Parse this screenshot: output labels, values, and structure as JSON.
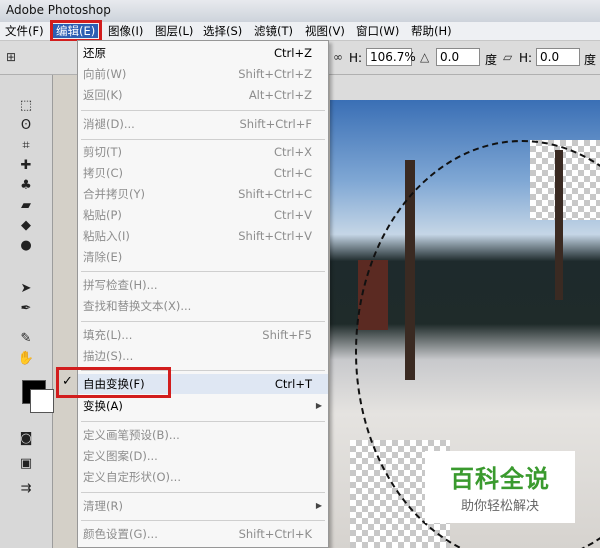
{
  "window": {
    "title": "Adobe Photoshop"
  },
  "menubar": {
    "items": [
      "文件(F)",
      "编辑(E)",
      "图像(I)",
      "图层(L)",
      "选择(S)",
      "滤镜(T)",
      "视图(V)",
      "窗口(W)",
      "帮助(H)"
    ],
    "active": "编辑(E)"
  },
  "options": {
    "h_label": "H:",
    "h_value": "106.7%",
    "angle_value": "0.0",
    "angle_unit": "度",
    "skew_h_label": "H:",
    "skew_h_value": "0.0",
    "skew_unit": "度"
  },
  "edit_menu": {
    "items": [
      {
        "label": "还原",
        "shortcut": "Ctrl+Z",
        "enabled": true
      },
      {
        "label": "向前(W)",
        "shortcut": "Shift+Ctrl+Z",
        "enabled": false
      },
      {
        "label": "返回(K)",
        "shortcut": "Alt+Ctrl+Z",
        "enabled": false
      },
      {
        "label": "消褪(D)...",
        "shortcut": "Shift+Ctrl+F",
        "enabled": false
      },
      {
        "label": "剪切(T)",
        "shortcut": "Ctrl+X",
        "enabled": false
      },
      {
        "label": "拷贝(C)",
        "shortcut": "Ctrl+C",
        "enabled": false
      },
      {
        "label": "合并拷贝(Y)",
        "shortcut": "Shift+Ctrl+C",
        "enabled": false
      },
      {
        "label": "粘贴(P)",
        "shortcut": "Ctrl+V",
        "enabled": false
      },
      {
        "label": "粘贴入(I)",
        "shortcut": "Shift+Ctrl+V",
        "enabled": false
      },
      {
        "label": "清除(E)",
        "shortcut": "",
        "enabled": false
      },
      {
        "label": "拼写检查(H)...",
        "shortcut": "",
        "enabled": false
      },
      {
        "label": "查找和替换文本(X)...",
        "shortcut": "",
        "enabled": false
      },
      {
        "label": "填充(L)...",
        "shortcut": "Shift+F5",
        "enabled": false
      },
      {
        "label": "描边(S)...",
        "shortcut": "",
        "enabled": false
      },
      {
        "label": "自由变换(F)",
        "shortcut": "Ctrl+T",
        "enabled": true,
        "checked": true
      },
      {
        "label": "变换(A)",
        "shortcut": "",
        "enabled": true,
        "submenu": true
      },
      {
        "label": "定义画笔预设(B)...",
        "shortcut": "",
        "enabled": false
      },
      {
        "label": "定义图案(D)...",
        "shortcut": "",
        "enabled": false
      },
      {
        "label": "定义自定形状(O)...",
        "shortcut": "",
        "enabled": false
      },
      {
        "label": "清理(R)",
        "shortcut": "",
        "enabled": false,
        "submenu": true
      },
      {
        "label": "颜色设置(G)...",
        "shortcut": "Shift+Ctrl+K",
        "enabled": false
      }
    ]
  },
  "watermark": {
    "title": "百科全说",
    "subtitle": "助你轻松解决"
  },
  "colors": {
    "highlight": "#d21d1d",
    "menu_active": "#2e5fb3",
    "watermark_green": "#3a9a2e"
  }
}
